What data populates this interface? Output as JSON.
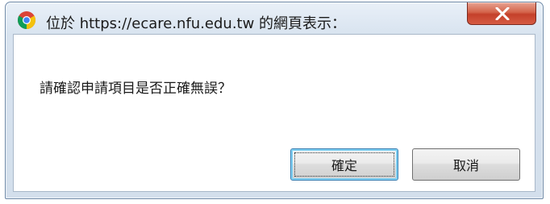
{
  "dialog": {
    "title": "位於 https://ecare.nfu.edu.tw 的網頁表示：",
    "app_icon": "chrome-icon",
    "close_icon": "close-icon",
    "message": "請確認申請項目是否正確無誤？",
    "ok_label": "確定",
    "cancel_label": "取消"
  },
  "colors": {
    "close_button": "#c4402a",
    "frame": "#d3dfec",
    "focus_glow": "#7fd0f3"
  }
}
